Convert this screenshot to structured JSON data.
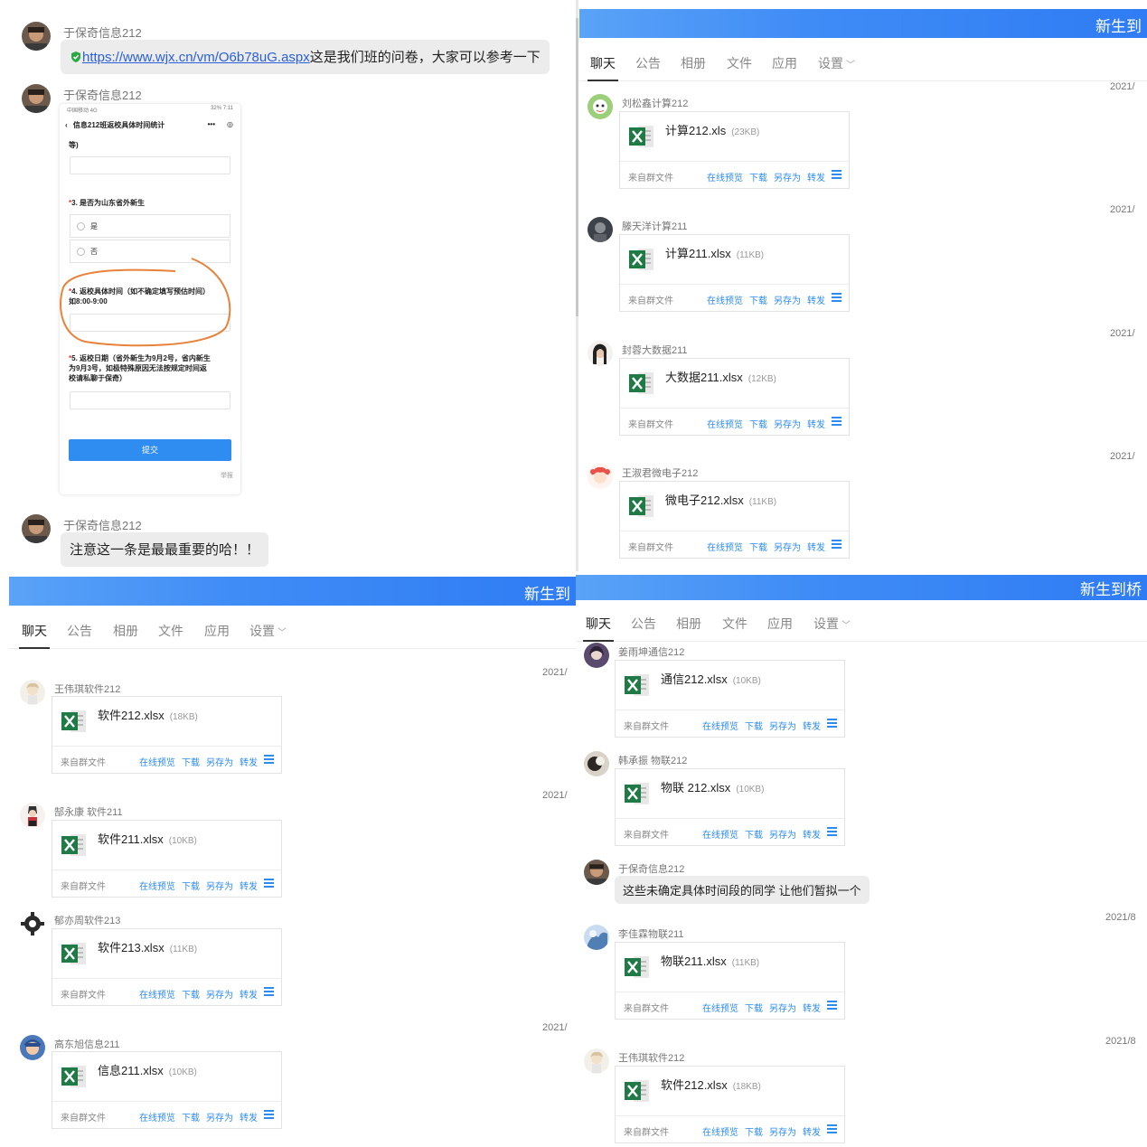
{
  "colors": {
    "banner_start": "#5aa3f7",
    "banner_end": "#2f7cf4",
    "link_blue": "#2d8cf0",
    "bubble_bg": "#ececec",
    "excel_green": "#1f7a45",
    "annotation_orange": "#e8823a"
  },
  "top_left": {
    "messages": [
      {
        "sender": "于保奇信息212",
        "icon": "shield-link-icon",
        "link": "https://www.wjx.cn/vm/O6b78uG.aspx",
        "text": "这是我们班的问卷，大家可以参考一下"
      },
      {
        "sender": "于保奇信息212"
      },
      {
        "sender": "于保奇信息212",
        "text": "注意这一条是最最重要的哈！！"
      }
    ],
    "phone": {
      "status_left": "中国移动 4G",
      "status_right": "32% 7:11",
      "title": "信息212班返校具体时间统计",
      "more": "•••",
      "truncated_text": "等)",
      "q3": "3. 是否为山东省外新生",
      "opt_yes": "是",
      "opt_no": "否",
      "q4_line1": "4. 返校具体时间（如不确定填写预估时间）",
      "q4_line2": "如8:00-9:00",
      "q5_line1": "5. 返校日期（省外新生为9月2号，省内新生",
      "q5_line2": "为9月3号，如极特殊原因无法按规定时间返",
      "q5_line3": "校请私聊于保奇）",
      "submit": "提交",
      "report": "举报"
    }
  },
  "top_right": {
    "banner": "新生到",
    "tabs": [
      "聊天",
      "公告",
      "相册",
      "文件",
      "应用",
      "设置"
    ],
    "entries": [
      {
        "date": "2021/",
        "sender": "刘松鑫计算212",
        "file": "计算212.xls",
        "size": "(23KB)"
      },
      {
        "date": "2021/",
        "sender": "滕天洋计算211",
        "file": "计算211.xlsx",
        "size": "(11KB)"
      },
      {
        "date": "2021/",
        "sender": "封蓉大数据211",
        "file": "大数据211.xlsx",
        "size": "(12KB)"
      },
      {
        "date": "2021/",
        "sender": "王淑君微电子212",
        "file": "微电子212.xlsx",
        "size": "(11KB)"
      }
    ]
  },
  "bottom_left": {
    "banner": "新生到",
    "tabs": [
      "聊天",
      "公告",
      "相册",
      "文件",
      "应用",
      "设置"
    ],
    "entries": [
      {
        "date": "2021/",
        "sender": "王伟琪软件212",
        "file": "软件212.xlsx",
        "size": "(18KB)"
      },
      {
        "date": "2021/",
        "sender": "郜永康 软件211",
        "file": "软件211.xlsx",
        "size": "(10KB)"
      },
      {
        "date": "",
        "sender": "郁亦周软件213",
        "file": "软件213.xlsx",
        "size": "(11KB)"
      },
      {
        "date": "2021/",
        "sender": "高东旭信息211",
        "file": "信息211.xlsx",
        "size": "(10KB)"
      }
    ]
  },
  "bottom_right": {
    "banner": "新生到桥",
    "tabs": [
      "聊天",
      "公告",
      "相册",
      "文件",
      "应用",
      "设置"
    ],
    "entries": [
      {
        "sender": "姜雨坤通信212",
        "file": "通信212.xlsx",
        "size": "(10KB)"
      },
      {
        "sender": "韩承振 物联212",
        "file": "物联 212.xlsx",
        "size": "(10KB)"
      },
      {
        "date": "2021/8",
        "sender": "李佳霖物联211",
        "file": "物联211.xlsx",
        "size": "(11KB)"
      },
      {
        "date": "2021/8",
        "sender": "王伟琪软件212",
        "file": "软件212.xlsx",
        "size": "(18KB)"
      }
    ],
    "text_message": {
      "sender": "于保奇信息212",
      "text": "这些未确定具体时间段的同学 让他们暂拟一个"
    }
  },
  "file_card": {
    "source": "来自群文件",
    "actions": [
      "在线预览",
      "下载",
      "另存为",
      "转发"
    ]
  }
}
